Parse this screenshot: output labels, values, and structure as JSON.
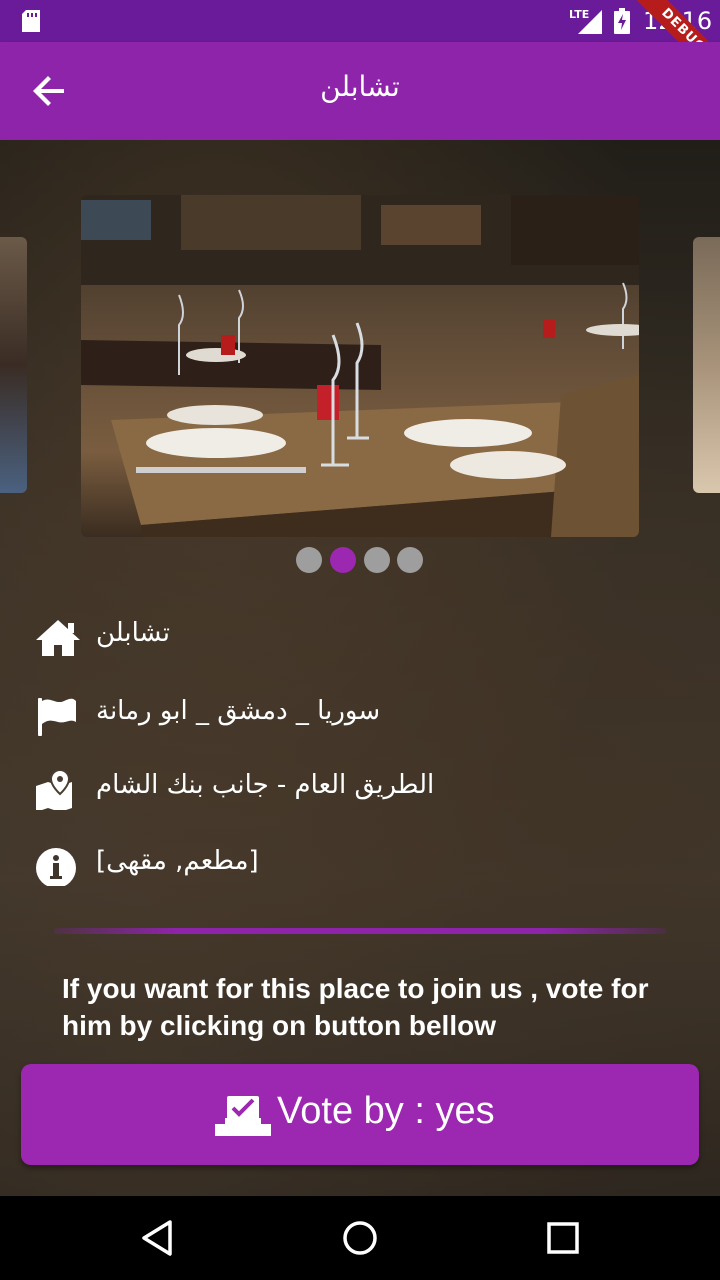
{
  "status_bar": {
    "network": "LTE",
    "time": "12:16",
    "debug_banner": "DEBUG"
  },
  "app_bar": {
    "title": "تشابلن",
    "back_icon": "arrow-back-icon"
  },
  "carousel": {
    "image_subject": "restaurant tables",
    "page_count": 4,
    "active_index": 1
  },
  "details": [
    {
      "icon": "home-icon",
      "text": "تشابلن"
    },
    {
      "icon": "flag-icon",
      "text": "سوريا _ دمشق _ ابو رمانة"
    },
    {
      "icon": "map-location-icon",
      "text": "الطريق العام - جانب بنك الشام"
    },
    {
      "icon": "info-icon",
      "text": "[مطعم, مقهى]"
    }
  ],
  "message": "If you want for this place to join us , vote for him by clicking on button bellow",
  "vote_button": {
    "label": "Vote by : yes",
    "icon": "vote-icon"
  },
  "colors": {
    "status_bar": "#6a1b9a",
    "app_bar": "#8e24aa",
    "accent": "#9c27b0",
    "dot_inactive": "#9e9e9e"
  }
}
